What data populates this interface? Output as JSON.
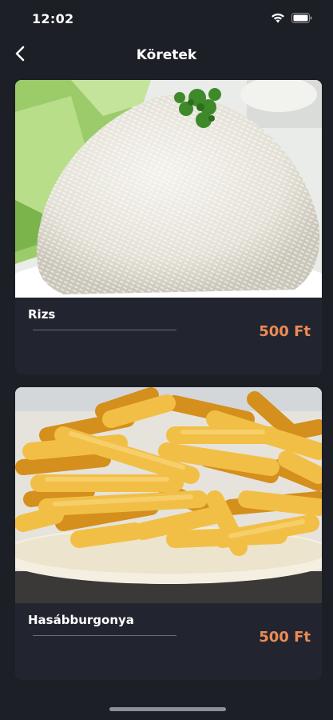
{
  "status_bar": {
    "time": "12:02",
    "icons": [
      "wifi-icon",
      "battery-icon"
    ]
  },
  "nav": {
    "title": "Köretek",
    "back_icon": "chevron-left-icon"
  },
  "items": [
    {
      "name": "Rizs",
      "price": "500 Ft",
      "image": "rice-photo"
    },
    {
      "name": "Hasábburgonya",
      "price": "500 Ft",
      "image": "french-fries-photo"
    }
  ],
  "colors": {
    "background": "#1c1f26",
    "card": "#222530",
    "price": "#ec8a55",
    "text": "#ffffff"
  }
}
